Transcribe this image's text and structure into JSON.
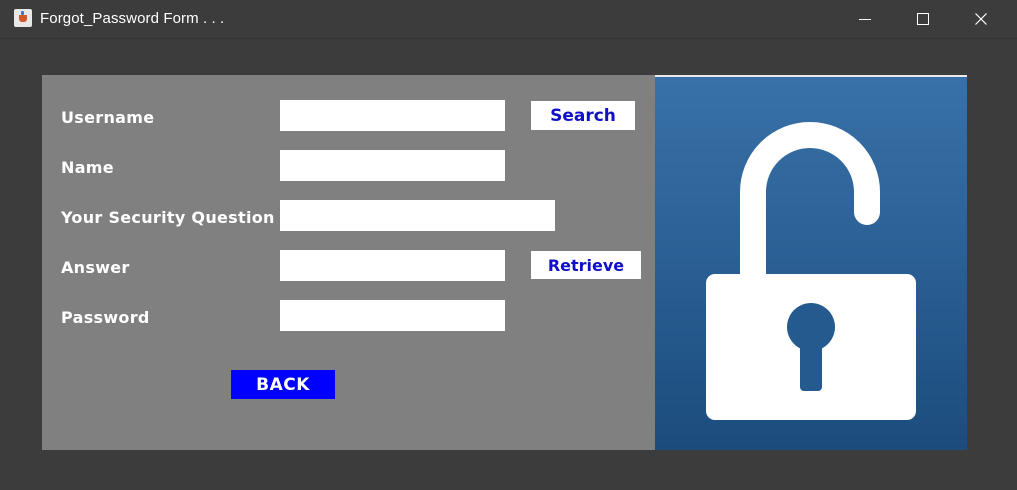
{
  "window": {
    "title": "Forgot_Password Form . . .",
    "icon": "java-cup-icon"
  },
  "form": {
    "username_label": "Username",
    "name_label": "Name",
    "question_label": "Your Security Question",
    "answer_label": "Answer",
    "password_label": "Password",
    "username_value": "",
    "name_value": "",
    "question_value": "",
    "answer_value": "",
    "password_value": ""
  },
  "buttons": {
    "search": "Search",
    "retrieve": "Retrieve",
    "back": "BACK"
  },
  "image": {
    "icon": "unlocked-padlock-icon"
  },
  "colors": {
    "panel_bg": "#808080",
    "back_button": "#0000ff",
    "button_text": "#1010c8",
    "image_bg": "#2a5f94"
  }
}
